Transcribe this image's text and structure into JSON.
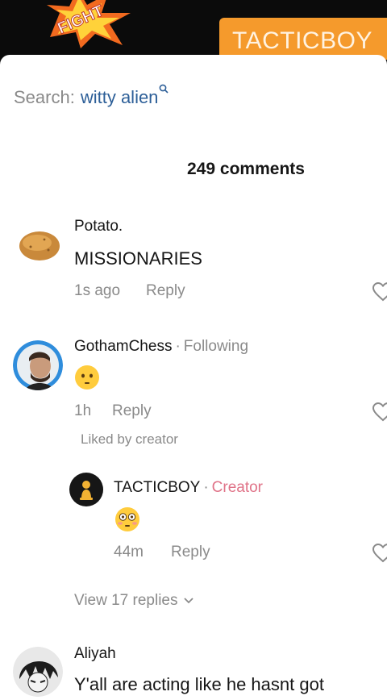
{
  "video": {
    "brand_label": "TACTICBOY"
  },
  "search": {
    "label": "Search:",
    "term": "witty alien"
  },
  "comments_count": "249 comments",
  "comments": [
    {
      "username": "Potato.",
      "text": "MISSIONARIES",
      "time": "1s ago",
      "reply_label": "Reply"
    },
    {
      "username": "GothamChess",
      "separator": "·",
      "tag": "Following",
      "time": "1h",
      "reply_label": "Reply",
      "liked_note": "Liked by creator",
      "replies": [
        {
          "username": "TACTICBOY",
          "separator": "·",
          "tag": "Creator",
          "time": "44m",
          "reply_label": "Reply"
        }
      ],
      "view_replies_label": "View 17 replies"
    },
    {
      "username": "Aliyah",
      "text": "Y'all are acting like he hasnt got"
    }
  ],
  "colors": {
    "accent_link": "#2d5f98",
    "creator_tag": "#e07388",
    "banner": "#f59a2c",
    "muted": "#8a8a8a"
  }
}
